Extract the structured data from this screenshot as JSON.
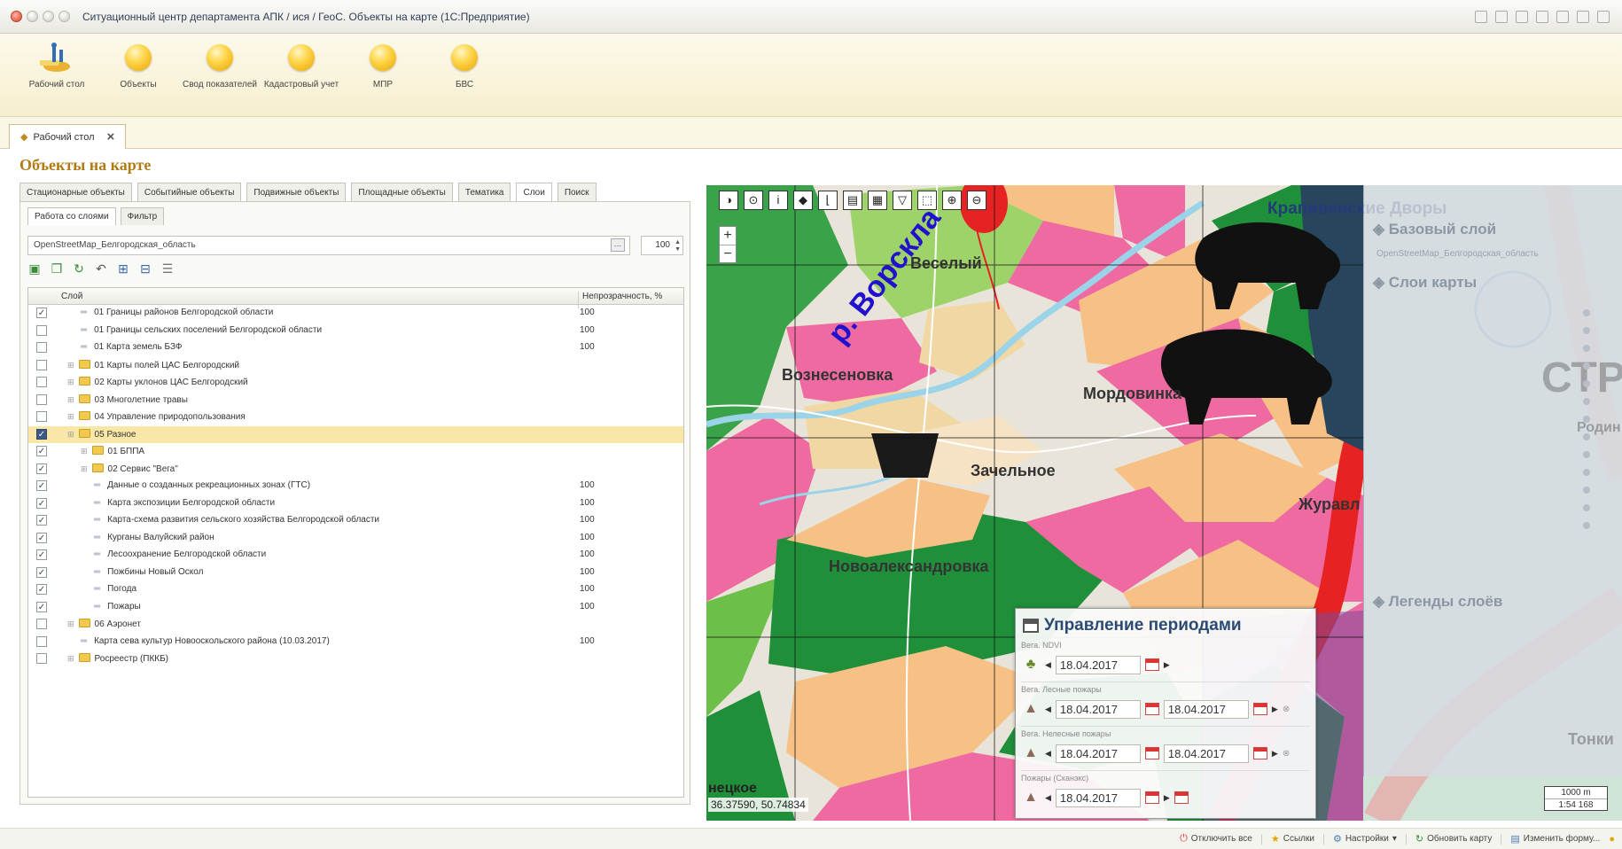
{
  "window": {
    "title": "Ситуационный центр департамента АПК / ися / ГеоС. Объекты на карте (1С:Предприятие)"
  },
  "sections": [
    {
      "label": "Рабочий стол",
      "icon": "desktop-icon"
    },
    {
      "label": "Объекты",
      "icon": "section-ball-icon"
    },
    {
      "label": "Свод показателей",
      "icon": "section-ball-icon"
    },
    {
      "label": "Кадастровый учет",
      "icon": "section-ball-icon"
    },
    {
      "label": "МПР",
      "icon": "section-ball-icon"
    },
    {
      "label": "БВС",
      "icon": "section-ball-icon"
    }
  ],
  "open_tab": {
    "label": "Рабочий стол"
  },
  "page_title": "Объекты на карте",
  "form_tabs": [
    "Стационарные объекты",
    "Событийные объекты",
    "Подвижные объекты",
    "Площадные объекты",
    "Тематика",
    "Слои",
    "Поиск"
  ],
  "sub_tabs": [
    "Работа со слоями",
    "Фильтр"
  ],
  "layer_field": {
    "value": "OpenStreetMap_Белгородская_область",
    "opacity": "100"
  },
  "grid": {
    "columns": {
      "layer": "Слой",
      "opacity": "Непрозрачность, %"
    },
    "rows": [
      {
        "checked": true,
        "indent": 1,
        "type": "layer",
        "name": "01 Границы районов Белгородской области",
        "opacity": "100"
      },
      {
        "checked": false,
        "indent": 1,
        "type": "layer",
        "name": "01 Границы сельских поселений Белгородской области",
        "opacity": "100"
      },
      {
        "checked": false,
        "indent": 1,
        "type": "layer",
        "name": "01 Карта земель БЗФ",
        "opacity": "100"
      },
      {
        "checked": false,
        "indent": 0,
        "type": "folder",
        "name": "01 Карты полей ЦАС Белгородский",
        "opacity": ""
      },
      {
        "checked": false,
        "indent": 0,
        "type": "folder",
        "name": "02 Карты уклонов ЦАС Белгородский",
        "opacity": ""
      },
      {
        "checked": false,
        "indent": 0,
        "type": "folder",
        "name": "03 Многолетние травы",
        "opacity": ""
      },
      {
        "checked": false,
        "indent": 0,
        "type": "folder",
        "name": "04 Управление природопользования",
        "opacity": ""
      },
      {
        "checked": true,
        "indent": 0,
        "type": "folder",
        "name": "05 Разное",
        "opacity": "",
        "selected": true
      },
      {
        "checked": true,
        "indent": 1,
        "type": "folder",
        "name": "01 БППА",
        "opacity": ""
      },
      {
        "checked": true,
        "indent": 1,
        "type": "folder",
        "name": "02 Сервис \"Вега\"",
        "opacity": ""
      },
      {
        "checked": true,
        "indent": 2,
        "type": "layer",
        "name": "Данные о созданных рекреационных зонах (ГТС)",
        "opacity": "100"
      },
      {
        "checked": true,
        "indent": 2,
        "type": "layer",
        "name": "Карта экспозиции Белгородской области",
        "opacity": "100"
      },
      {
        "checked": true,
        "indent": 2,
        "type": "layer",
        "name": "Карта-схема развития сельского хозяйства Белгородской области",
        "opacity": "100"
      },
      {
        "checked": true,
        "indent": 2,
        "type": "layer",
        "name": "Курганы Валуйский район",
        "opacity": "100"
      },
      {
        "checked": true,
        "indent": 2,
        "type": "layer",
        "name": "Лесоохранение Белгородской области",
        "opacity": "100"
      },
      {
        "checked": true,
        "indent": 2,
        "type": "layer",
        "name": "Пожбины Новый Оскол",
        "opacity": "100"
      },
      {
        "checked": true,
        "indent": 2,
        "type": "layer",
        "name": "Погода",
        "opacity": "100"
      },
      {
        "checked": true,
        "indent": 2,
        "type": "layer",
        "name": "Пожары",
        "opacity": "100"
      },
      {
        "checked": false,
        "indent": 0,
        "type": "folder",
        "name": "06 Аэронет",
        "opacity": ""
      },
      {
        "checked": false,
        "indent": 1,
        "type": "layer",
        "name": "Карта сева культур Новооскольского района (10.03.2017)",
        "opacity": "100"
      },
      {
        "checked": false,
        "indent": 0,
        "type": "folder",
        "name": "Росреестр (ПККБ)",
        "opacity": ""
      }
    ]
  },
  "map": {
    "labels": {
      "kraпivenskie": "Крапивенские Дворы",
      "veselyi": "Веселый",
      "vorskla": "р. Ворскла",
      "voznesenovka": "Вознесеновка",
      "mordovinka": "Мордовинка",
      "zachelnoe": "Зачельное",
      "zhuravl": "Журавл",
      "novoaleksandrovka": "Новоалександровка",
      "bottom_left": "нецкое",
      "str": "СТР",
      "rodin": "Родин",
      "tonki": "Тонки"
    },
    "coords": "36.37590, 50.74834",
    "scale": {
      "distance": "1000 m",
      "ratio": "1:54 168"
    },
    "zoom": {
      "in": "+",
      "out": "−"
    },
    "overlay": {
      "base_layer": "Базовый слой",
      "base_layer_value": "OpenStreetMap_Белгородская_область",
      "map_layers": "Слои карты",
      "legends": "Легенды слоёв"
    }
  },
  "periods": {
    "title": "Управление периодами",
    "groups": [
      {
        "label": "Вега. NDVI",
        "icon": "tree-icon",
        "dates": [
          "18.04.2017"
        ]
      },
      {
        "label": "Вега. Лесные пожары",
        "icon": "fire-icon",
        "dates": [
          "18.04.2017",
          "18.04.2017"
        ]
      },
      {
        "label": "Вега. Нелесные пожары",
        "icon": "fire-icon",
        "dates": [
          "18.04.2017",
          "18.04.2017"
        ]
      },
      {
        "label": "Пожары (Сканэкс)",
        "icon": "fire-icon",
        "dates": [
          "18.04.2017"
        ]
      }
    ]
  },
  "status": [
    {
      "label": "Отключить все",
      "icon": "power-icon"
    },
    {
      "label": "Ссылки",
      "icon": "star-icon"
    },
    {
      "label": "Настройки",
      "icon": "settings-icon"
    },
    {
      "label": "Обновить карту",
      "icon": "refresh-icon"
    },
    {
      "label": "Изменить форму...",
      "icon": "form-icon"
    }
  ],
  "colors": {
    "accent": "#b07a14",
    "selected_row": "#f8e7a6",
    "map_river": "#9bd3e8",
    "fields_orange": "#f7c084",
    "fields_pink": "#ef6aa1",
    "forest_green": "#1f8f3a"
  }
}
